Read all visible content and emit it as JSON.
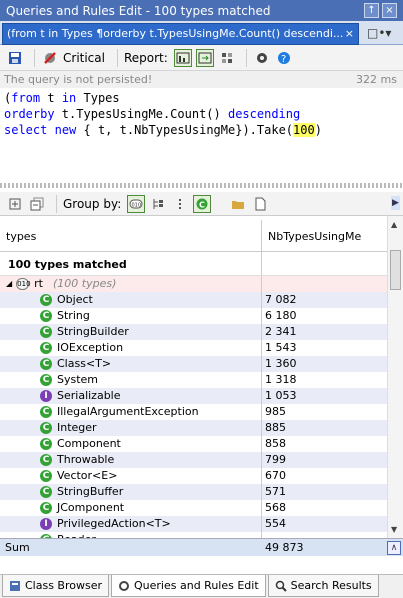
{
  "window": {
    "title": "Queries and Rules Edit - 100 types matched"
  },
  "doc_tab": {
    "label": "(from t in Types ¶orderby t.TypesUsingMe.Count() descendi..."
  },
  "toolbar": {
    "critical_label": "Critical",
    "report_label": "Report:"
  },
  "status": {
    "message": "The query is not persisted!",
    "time": "322 ms"
  },
  "code": {
    "line1_a": "(",
    "line1_kw1": "from",
    "line1_b": " t ",
    "line1_kw2": "in",
    "line1_c": " Types",
    "line2_kw": "orderby",
    "line2_rest": " t.TypesUsingMe.Count() ",
    "line2_kw2": "descending",
    "line3_kw1": "select",
    "line3_b": " ",
    "line3_kw2": "new",
    "line3_c": " { t,  t.NbTypesUsingMe}).Take(",
    "line3_num": "100",
    "line3_d": ")"
  },
  "toolbar2": {
    "group_by_label": "Group by:"
  },
  "grid": {
    "columns": [
      "types",
      "NbTypesUsingMe"
    ],
    "matched_label": "100 types matched",
    "group": {
      "name": "rt",
      "count_label": "(100 types)"
    },
    "rows": [
      {
        "name": "Object",
        "value": "7 082",
        "kind": "C"
      },
      {
        "name": "String",
        "value": "6 180",
        "kind": "C"
      },
      {
        "name": "StringBuilder",
        "value": "2 341",
        "kind": "C"
      },
      {
        "name": "IOException",
        "value": "1 543",
        "kind": "C"
      },
      {
        "name": "Class<T>",
        "value": "1 360",
        "kind": "C"
      },
      {
        "name": "System",
        "value": "1 318",
        "kind": "C"
      },
      {
        "name": "Serializable",
        "value": "1 053",
        "kind": "I"
      },
      {
        "name": "IllegalArgumentException",
        "value": "985",
        "kind": "C"
      },
      {
        "name": "Integer",
        "value": "885",
        "kind": "C"
      },
      {
        "name": "Component",
        "value": "858",
        "kind": "C"
      },
      {
        "name": "Throwable",
        "value": "799",
        "kind": "C"
      },
      {
        "name": "Vector<E>",
        "value": "670",
        "kind": "C"
      },
      {
        "name": "StringBuffer",
        "value": "571",
        "kind": "C"
      },
      {
        "name": "JComponent",
        "value": "568",
        "kind": "C"
      },
      {
        "name": "PrivilegedAction<T>",
        "value": "554",
        "kind": "I"
      },
      {
        "name": "Reader",
        "value": "",
        "kind": "C"
      }
    ],
    "sum_label": "Sum",
    "sum_value": "49 873"
  },
  "bottom_tabs": [
    "Class Browser",
    "Queries and Rules Edit",
    "Search Results"
  ],
  "colors": {
    "title_bg": "#4a6fb5",
    "tab_active": "#2d6ac9",
    "class_icon": "#34a336",
    "interface_icon": "#7b3fb4"
  }
}
